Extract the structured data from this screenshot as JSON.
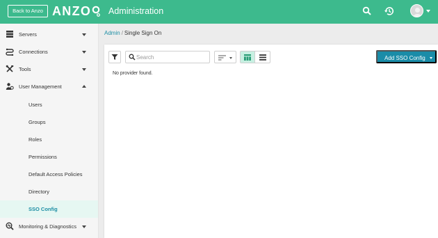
{
  "topbar": {
    "back_label": "Back to Anzo",
    "logo_text": "ANZO",
    "title": "Administration",
    "icons": [
      "search-icon",
      "history-icon",
      "avatar",
      "chevron-down-icon"
    ],
    "color": "#3dba8d"
  },
  "sidebar": {
    "sections": [
      {
        "label": "Servers",
        "icon": "server-icon",
        "expanded": false
      },
      {
        "label": "Connections",
        "icon": "connections-icon",
        "expanded": false
      },
      {
        "label": "Tools",
        "icon": "tools-icon",
        "expanded": false
      },
      {
        "label": "User Management",
        "icon": "user-management-icon",
        "expanded": true
      },
      {
        "label": "Monitoring & Diagnostics",
        "icon": "monitoring-icon",
        "expanded": false
      }
    ],
    "user_management_items": [
      {
        "label": "Users"
      },
      {
        "label": "Groups"
      },
      {
        "label": "Roles"
      },
      {
        "label": "Permissions"
      },
      {
        "label": "Default Access Policies"
      },
      {
        "label": "Directory"
      },
      {
        "label": "SSO Config",
        "active": true
      }
    ],
    "active_color": "#1e8fa5"
  },
  "breadcrumb": {
    "parent": "Admin",
    "separator": "/",
    "current": "Single Sign On"
  },
  "toolbar": {
    "search_placeholder": "Search",
    "search_value": "",
    "add_label": "Add SSO Config",
    "add_color": "#1a8ca8",
    "view_mode": "grid"
  },
  "content": {
    "empty_message": "No provider found."
  }
}
